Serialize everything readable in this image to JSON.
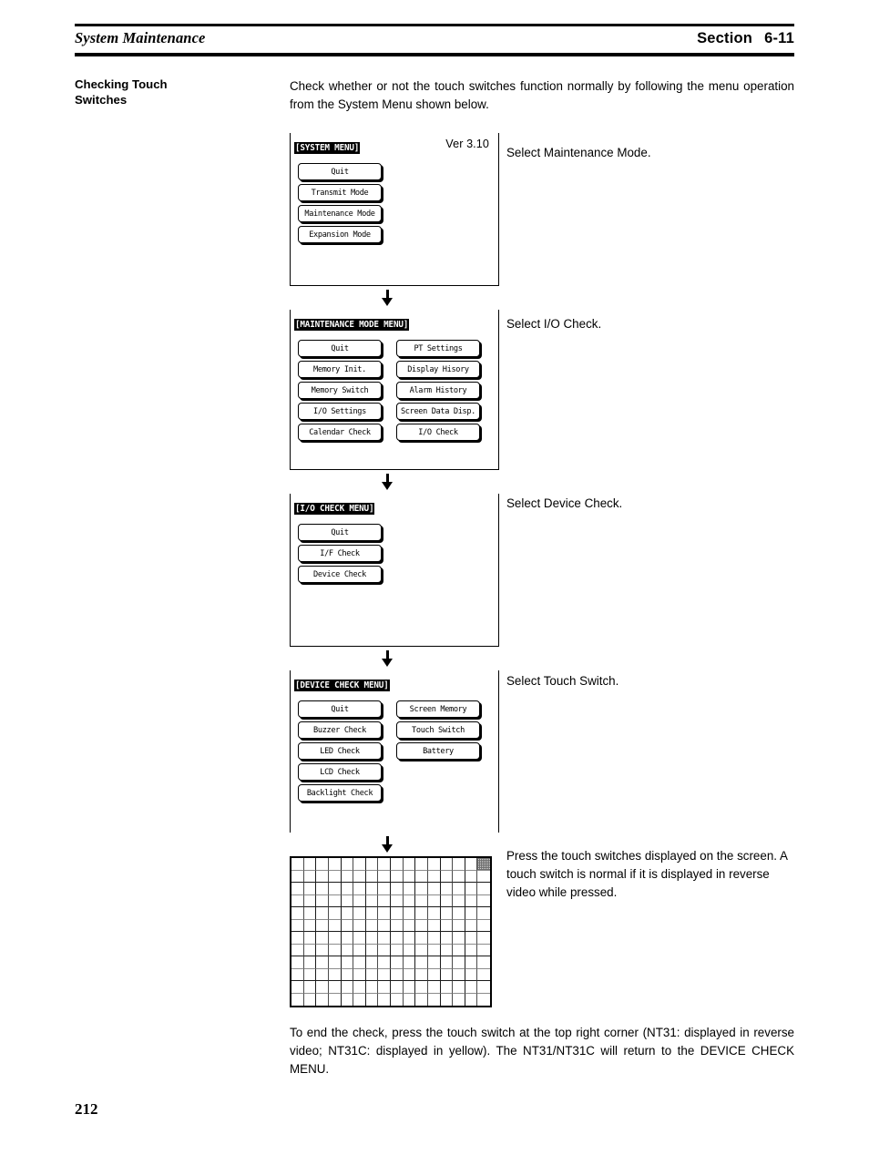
{
  "header": {
    "title": "System Maintenance",
    "section_label": "Section",
    "section_number": "6-11"
  },
  "side_heading": "Checking Touch\nSwitches",
  "intro": "Check whether or not the touch switches function normally by following the menu operation from the System Menu shown below.",
  "flow": {
    "panels": [
      {
        "title": "[SYSTEM MENU]",
        "version": "Ver 3.10",
        "columns": [
          [
            "Quit",
            "Transmit Mode",
            "Maintenance Mode",
            "Expansion Mode"
          ]
        ],
        "caption": "Select Maintenance Mode."
      },
      {
        "title": "[MAINTENANCE MODE MENU]",
        "version": "",
        "columns": [
          [
            "Quit",
            "Memory Init.",
            "Memory Switch",
            "I/O Settings",
            "Calendar Check"
          ],
          [
            "PT Settings",
            "Display Hisory",
            "Alarm History",
            "Screen Data Disp.",
            "I/O Check"
          ]
        ],
        "caption": "Select I/O Check."
      },
      {
        "title": "[I/O CHECK MENU]",
        "version": "",
        "columns": [
          [
            "Quit",
            "I/F Check",
            "Device Check"
          ]
        ],
        "caption": "Select Device Check."
      },
      {
        "title": "[DEVICE CHECK MENU]",
        "version": "",
        "columns": [
          [
            "Quit",
            "Buzzer Check",
            "LED Check",
            "LCD Check",
            "Backlight Check"
          ],
          [
            "Screen Memory",
            "Touch Switch",
            "Battery"
          ]
        ],
        "caption": "Select Touch Switch."
      }
    ],
    "touch_grid": {
      "columns": 16,
      "rows": 12,
      "pressed_cell": {
        "row": 0,
        "col": 15
      },
      "caption": "Press the touch switches displayed on the screen. A touch switch is normal if it is displayed in reverse video while pressed."
    }
  },
  "closing": "To end the check, press the touch switch at the top right corner (NT31: displayed in reverse video; NT31C: displayed in yellow). The NT31/NT31C will return to the DEVICE CHECK MENU.",
  "page_number": "212",
  "colors": {
    "ink": "#000000",
    "paper": "#ffffff",
    "grid_line": "#4a4a4a",
    "grid_line_light": "#8c8c8c"
  }
}
